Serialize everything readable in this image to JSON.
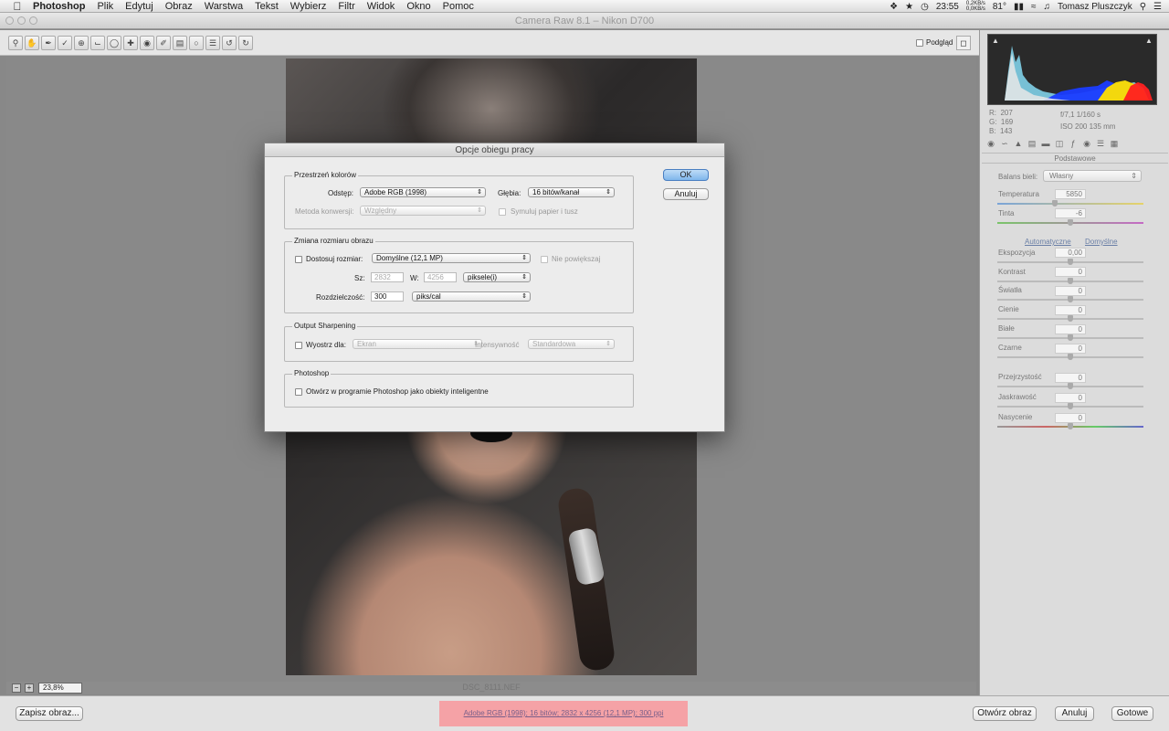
{
  "menubar": {
    "app": "Photoshop",
    "menus": [
      "Plik",
      "Edytuj",
      "Obraz",
      "Warstwa",
      "Tekst",
      "Wybierz",
      "Filtr",
      "Widok",
      "Okno",
      "Pomoc"
    ],
    "clock": "23:55",
    "net_up": "0,2KB/s",
    "net_down": "0,0KB/s",
    "temp": "81°",
    "user": "Tomasz Pluszczyk"
  },
  "window": {
    "title": "Camera Raw 8.1  –  Nikon D700"
  },
  "toolbar": {
    "preview_label": "Podgląd",
    "preview_checked": true
  },
  "canvas": {
    "zoom": "23,8%",
    "filename": "DSC_8111.NEF"
  },
  "histogram": {
    "rgb": {
      "r": "207",
      "g": "169",
      "b": "143"
    },
    "aperture_shutter": "f/7,1   1/160 s",
    "iso_focal": "ISO 200   135 mm"
  },
  "panel": {
    "title": "Podstawowe",
    "white_balance_label": "Balans bieli:",
    "white_balance_value": "Własny",
    "temperature_label": "Temperatura",
    "temperature_value": "5850",
    "tint_label": "Tinta",
    "tint_value": "-6",
    "auto_link": "Automatyczne",
    "default_link": "Domyślne",
    "sliders": [
      {
        "label": "Ekspozycja",
        "value": "0,00"
      },
      {
        "label": "Kontrast",
        "value": "0"
      },
      {
        "label": "Światła",
        "value": "0"
      },
      {
        "label": "Cienie",
        "value": "0"
      },
      {
        "label": "Białe",
        "value": "0"
      },
      {
        "label": "Czarne",
        "value": "0"
      },
      {
        "label": "Przejrzystość",
        "value": "0"
      },
      {
        "label": "Jaskrawość",
        "value": "0"
      },
      {
        "label": "Nasycenie",
        "value": "0"
      }
    ]
  },
  "bottom": {
    "save": "Zapisz obraz...",
    "workflow": "Adobe RGB (1998); 16 bitów; 2832 x 4256 (12,1 MP); 300 ppi",
    "open": "Otwórz obraz",
    "cancel": "Anuluj",
    "done": "Gotowe"
  },
  "dialog": {
    "title": "Opcje obiegu pracy",
    "ok": "OK",
    "cancel": "Anuluj",
    "color_space": {
      "group": "Przestrzeń kolorów",
      "space_label": "Odstęp:",
      "space_value": "Adobe RGB (1998)",
      "depth_label": "Głębia:",
      "depth_value": "16 bitów/kanał",
      "intent_label": "Metoda konwersji:",
      "intent_value": "Względny",
      "simulate_label": "Symuluj papier i tusz"
    },
    "resize": {
      "group": "Zmiana rozmiaru obrazu",
      "fit_label": "Dostosuj rozmiar:",
      "fit_value": "Domyślne (12,1 MP)",
      "no_enlarge": "Nie powiększaj",
      "w_label": "Sz:",
      "w_value": "2832",
      "h_label": "W:",
      "h_value": "4256",
      "units_value": "piksele(i)",
      "res_label": "Rozdzielczość:",
      "res_value": "300",
      "res_units": "piks/cal"
    },
    "sharpen": {
      "group": "Output Sharpening",
      "sharpen_label": "Wyostrz dla:",
      "sharpen_value": "Ekran",
      "amount_label": "Intensywność",
      "amount_value": "Standardowa"
    },
    "photoshop": {
      "group": "Photoshop",
      "smart_label": "Otwórz w programie Photoshop jako obiekty inteligentne"
    }
  }
}
